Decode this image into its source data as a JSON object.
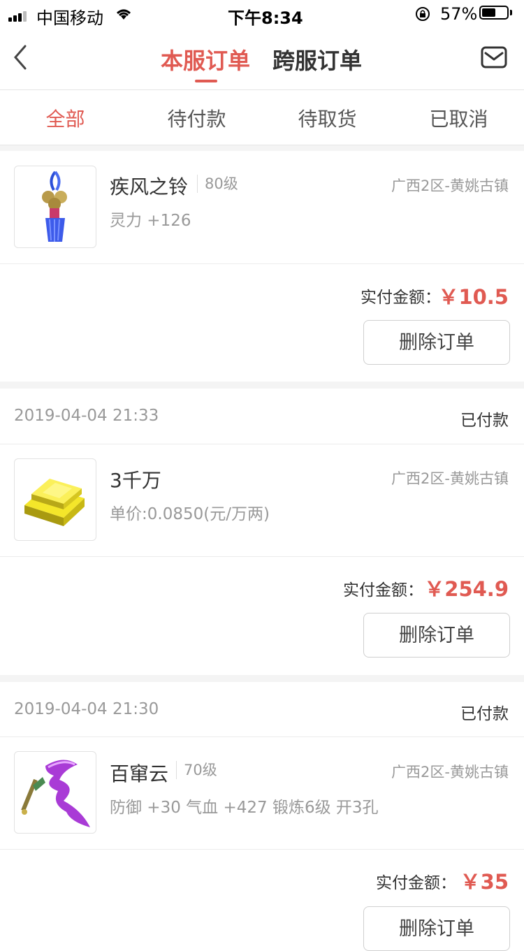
{
  "status_bar": {
    "carrier": "中国移动",
    "time": "下午8:34",
    "battery": "57%",
    "battery_level": 0.57
  },
  "header": {
    "tab_local": "本服订单",
    "tab_cross": "跨服订单",
    "accent_color": "#e05a52"
  },
  "filter_tabs": [
    "全部",
    "待付款",
    "待取货",
    "已取消"
  ],
  "orders": [
    {
      "time": "",
      "status": "",
      "name": "疾风之铃",
      "level": "80级",
      "server": "广西2区-黄姚古镇",
      "attr": "灵力 +126",
      "pay_label": "实付金额：",
      "amount": "￥10.5",
      "delete_label": "删除订单",
      "thumb_icon": "bell-tassel-icon"
    },
    {
      "time": "2019-04-04 21:33",
      "status": "已付款",
      "name": "3千万",
      "level": "",
      "server": "广西2区-黄姚古镇",
      "attr": "单价:0.0850(元/万两)",
      "pay_label": "实付金额：",
      "amount": "￥254.9",
      "delete_label": "删除订单",
      "thumb_icon": "gold-bars-icon"
    },
    {
      "time": "2019-04-04 21:30",
      "status": "已付款",
      "name": "百窜云",
      "level": "70级",
      "server": "广西2区-黄姚古镇",
      "attr": "防御 +30 气血 +427 锻炼6级 开3孔",
      "pay_label": "实付金额：",
      "amount": "￥35",
      "delete_label": "删除订单",
      "thumb_icon": "purple-ribbon-icon"
    }
  ]
}
